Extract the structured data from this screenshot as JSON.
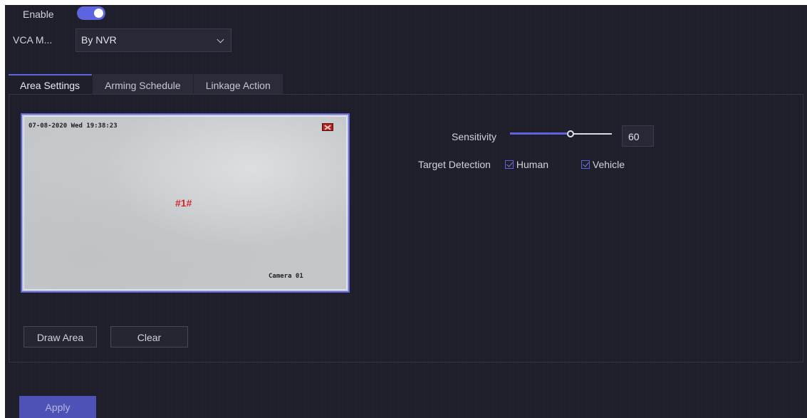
{
  "enable": {
    "label": "Enable",
    "on": true
  },
  "vca_mode": {
    "label": "VCA M...",
    "value": "By NVR"
  },
  "tabs": [
    {
      "label": "Area Settings",
      "active": true
    },
    {
      "label": "Arming Schedule",
      "active": false
    },
    {
      "label": "Linkage Action",
      "active": false
    }
  ],
  "camera": {
    "timestamp": "07-08-2020 Wed 19:38:23",
    "name": "Camera 01",
    "zone_label": "#1#"
  },
  "sensitivity": {
    "label": "Sensitivity",
    "value": "60",
    "level": 0.6
  },
  "target_detection": {
    "label": "Target Detection",
    "options": [
      {
        "label": "Human",
        "checked": true
      },
      {
        "label": "Vehicle",
        "checked": true
      }
    ]
  },
  "buttons": {
    "draw_area": "Draw Area",
    "clear": "Clear",
    "apply": "Apply"
  },
  "colors": {
    "accent": "#5e63e0",
    "background": "#1f1f2b",
    "zone_label": "#d62828"
  }
}
